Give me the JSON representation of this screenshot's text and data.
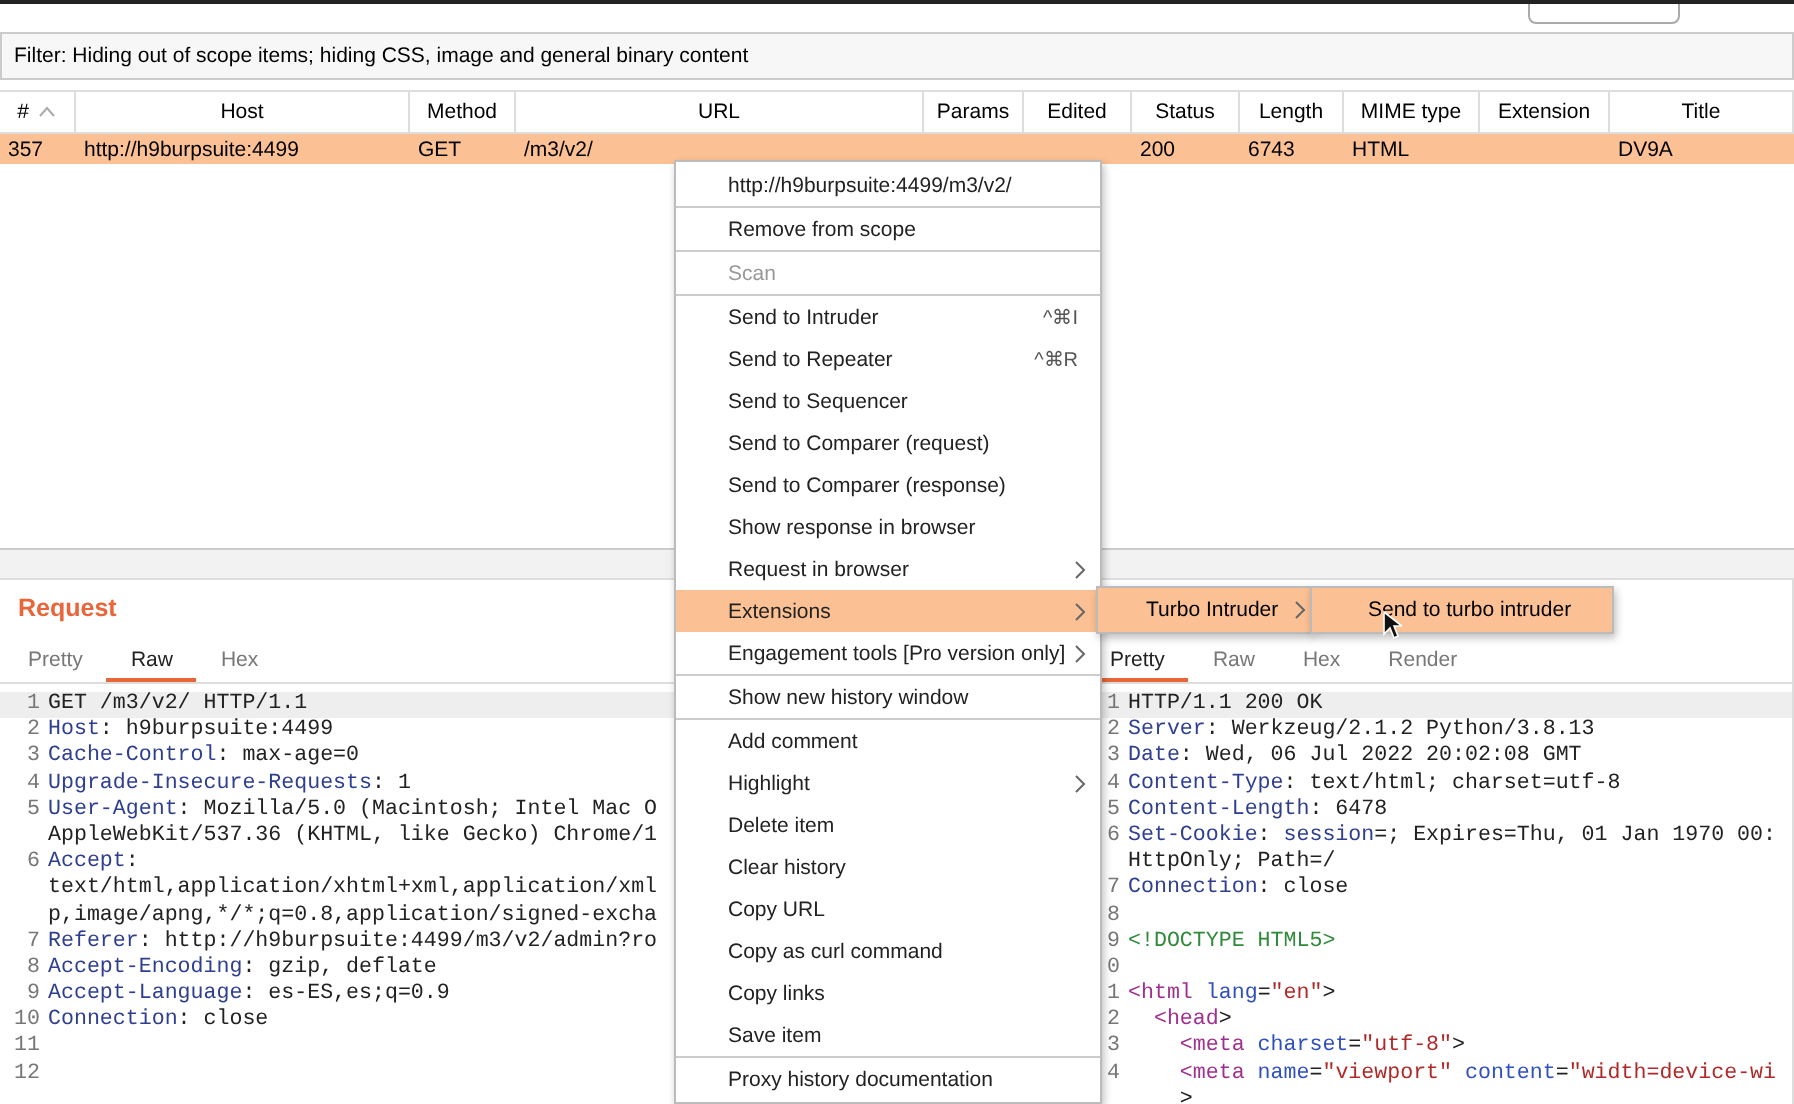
{
  "filter": "Filter: Hiding out of scope items;  hiding CSS, image and general binary content",
  "table": {
    "columns": [
      {
        "label": "#",
        "sorted": true
      },
      {
        "label": "Host",
        "sorted": false
      },
      {
        "label": "Method",
        "sorted": false
      },
      {
        "label": "URL",
        "sorted": false
      },
      {
        "label": "Params",
        "sorted": false
      },
      {
        "label": "Edited",
        "sorted": false
      },
      {
        "label": "Status",
        "sorted": false
      },
      {
        "label": "Length",
        "sorted": false
      },
      {
        "label": "MIME type",
        "sorted": false
      },
      {
        "label": "Extension",
        "sorted": false
      },
      {
        "label": "Title",
        "sorted": false
      }
    ],
    "rows": [
      {
        "selected": true,
        "cells": [
          "357",
          "http://h9burpsuite:4499",
          "GET",
          "/m3/v2/",
          null,
          null,
          "200",
          "6743",
          "HTML",
          null,
          "DV9A"
        ]
      }
    ]
  },
  "request": {
    "title": "Request",
    "tabs": [
      {
        "label": "Pretty",
        "selected": false
      },
      {
        "label": "Raw",
        "selected": true
      },
      {
        "label": "Hex",
        "selected": false
      }
    ],
    "lines": [
      {
        "n": "1",
        "segs": [
          {
            "kind": "plain",
            "text": "GET /m3/v2/ HTTP/1.1"
          }
        ]
      },
      {
        "n": "2",
        "segs": [
          {
            "kind": "key",
            "text": "Host"
          },
          {
            "kind": "plain",
            "text": ": h9burpsuite:4499"
          }
        ]
      },
      {
        "n": "3",
        "segs": [
          {
            "kind": "key",
            "text": "Cache-Control"
          },
          {
            "kind": "plain",
            "text": ": max-age=0"
          }
        ]
      },
      {
        "n": "4",
        "segs": [
          {
            "kind": "key",
            "text": "Upgrade-Insecure-Requests"
          },
          {
            "kind": "plain",
            "text": ": 1"
          }
        ]
      },
      {
        "n": "5",
        "segs": [
          {
            "kind": "key",
            "text": "User-Agent"
          },
          {
            "kind": "plain",
            "text": ": Mozilla/5.0 (Macintosh; Intel Mac O"
          }
        ]
      },
      {
        "segs": [
          {
            "kind": "plain",
            "text": "AppleWebKit/537.36 (KHTML, like Gecko) Chrome/1"
          }
        ]
      },
      {
        "n": "6",
        "segs": [
          {
            "kind": "key",
            "text": "Accept"
          },
          {
            "kind": "plain",
            "text": ":"
          }
        ]
      },
      {
        "segs": [
          {
            "kind": "plain",
            "text": "text/html,application/xhtml+xml,application/xml"
          }
        ]
      },
      {
        "segs": [
          {
            "kind": "plain",
            "text": "p,image/apng,*/*;q=0.8,application/signed-excha"
          }
        ]
      },
      {
        "n": "7",
        "segs": [
          {
            "kind": "key",
            "text": "Referer"
          },
          {
            "kind": "plain",
            "text": ": http://h9burpsuite:4499/m3/v2/admin?ro"
          }
        ]
      },
      {
        "n": "8",
        "segs": [
          {
            "kind": "key",
            "text": "Accept-Encoding"
          },
          {
            "kind": "plain",
            "text": ": gzip, deflate"
          }
        ]
      },
      {
        "n": "9",
        "segs": [
          {
            "kind": "key",
            "text": "Accept-Language"
          },
          {
            "kind": "plain",
            "text": ": es-ES,es;q=0.9"
          }
        ]
      },
      {
        "n": "10",
        "segs": [
          {
            "kind": "key",
            "text": "Connection"
          },
          {
            "kind": "plain",
            "text": ": close"
          }
        ]
      },
      {
        "n": "11"
      },
      {
        "n": "12"
      }
    ]
  },
  "response": {
    "tabs": [
      {
        "label": "Pretty",
        "selected": true
      },
      {
        "label": "Raw",
        "selected": false
      },
      {
        "label": "Hex",
        "selected": false
      },
      {
        "label": "Render",
        "selected": false
      }
    ],
    "lines": [
      {
        "n": "1",
        "segs": [
          {
            "kind": "plain",
            "text": "HTTP/1.1 200 OK"
          }
        ]
      },
      {
        "n": "2",
        "segs": [
          {
            "kind": "key",
            "text": "Server"
          },
          {
            "kind": "plain",
            "text": ": Werkzeug/2.1.2 Python/3.8.13"
          }
        ]
      },
      {
        "n": "3",
        "segs": [
          {
            "kind": "key",
            "text": "Date"
          },
          {
            "kind": "plain",
            "text": ": Wed, 06 Jul 2022 20:02:08 GMT"
          }
        ]
      },
      {
        "n": "4",
        "segs": [
          {
            "kind": "key",
            "text": "Content-Type"
          },
          {
            "kind": "plain",
            "text": ": text/html; charset=utf-8"
          }
        ]
      },
      {
        "n": "5",
        "segs": [
          {
            "kind": "key",
            "text": "Content-Length"
          },
          {
            "kind": "plain",
            "text": ": 6478"
          }
        ]
      },
      {
        "n": "6",
        "segs": [
          {
            "kind": "key",
            "text": "Set-Cookie"
          },
          {
            "kind": "plain",
            "text": ": "
          },
          {
            "kind": "key",
            "text": "session"
          },
          {
            "kind": "plain",
            "text": "=; Expires=Thu, 01 Jan 1970 00:"
          }
        ]
      },
      {
        "segs": [
          {
            "kind": "plain",
            "text": "HttpOnly; Path=/"
          }
        ]
      },
      {
        "n": "7",
        "segs": [
          {
            "kind": "key",
            "text": "Connection"
          },
          {
            "kind": "plain",
            "text": ": close"
          }
        ]
      },
      {
        "n": "8"
      },
      {
        "n": "9",
        "segs": [
          {
            "kind": "doctype",
            "text": "<!DOCTYPE HTML5>"
          }
        ]
      },
      {
        "n": "0"
      },
      {
        "n": "1",
        "segs": [
          {
            "kind": "tag",
            "text": "<html"
          },
          {
            "kind": "attr",
            "text": " lang"
          },
          {
            "kind": "plain",
            "text": "="
          },
          {
            "kind": "string",
            "text": "\"en\""
          },
          {
            "kind": "plain",
            "text": ">"
          }
        ]
      },
      {
        "n": "2",
        "segs": [
          {
            "kind": "tag",
            "text": "  <head"
          },
          {
            "kind": "plain",
            "text": ">"
          }
        ]
      },
      {
        "n": "3",
        "segs": [
          {
            "kind": "tag",
            "text": "    <meta"
          },
          {
            "kind": "attr",
            "text": " charset"
          },
          {
            "kind": "plain",
            "text": "="
          },
          {
            "kind": "string",
            "text": "\"utf-8\""
          },
          {
            "kind": "plain",
            "text": ">"
          }
        ]
      },
      {
        "n": "4",
        "segs": [
          {
            "kind": "tag",
            "text": "    <meta"
          },
          {
            "kind": "attr",
            "text": " name"
          },
          {
            "kind": "plain",
            "text": "="
          },
          {
            "kind": "string",
            "text": "\"viewport\""
          },
          {
            "kind": "attr",
            "text": " content"
          },
          {
            "kind": "plain",
            "text": "="
          },
          {
            "kind": "string",
            "text": "\"width=device-wi"
          }
        ]
      },
      {
        "segs": [
          {
            "kind": "plain",
            "text": "    >"
          }
        ]
      }
    ]
  },
  "context_menu": {
    "groups": [
      [
        {
          "label": "http://h9burpsuite:4499/m3/v2/",
          "disabled": false,
          "selected": false,
          "submenu": false
        }
      ],
      [
        {
          "label": "Remove from scope",
          "disabled": false,
          "selected": false,
          "submenu": false
        }
      ],
      [
        {
          "label": "Scan",
          "disabled": true,
          "selected": false,
          "submenu": false
        }
      ],
      [
        {
          "label": "Send to Intruder",
          "shortcut": "^⌘I",
          "disabled": false,
          "selected": false,
          "submenu": false
        },
        {
          "label": "Send to Repeater",
          "shortcut": "^⌘R",
          "disabled": false,
          "selected": false,
          "submenu": false
        },
        {
          "label": "Send to Sequencer",
          "disabled": false,
          "selected": false,
          "submenu": false
        },
        {
          "label": "Send to Comparer (request)",
          "disabled": false,
          "selected": false,
          "submenu": false
        },
        {
          "label": "Send to Comparer (response)",
          "disabled": false,
          "selected": false,
          "submenu": false
        },
        {
          "label": "Show response in browser",
          "disabled": false,
          "selected": false,
          "submenu": false
        },
        {
          "label": "Request in browser",
          "disabled": false,
          "selected": false,
          "submenu": true
        },
        {
          "label": "Extensions",
          "disabled": false,
          "selected": true,
          "submenu": true
        },
        {
          "label": "Engagement tools [Pro version only]",
          "disabled": false,
          "selected": false,
          "submenu": true
        }
      ],
      [
        {
          "label": "Show new history window",
          "disabled": false,
          "selected": false,
          "submenu": false
        }
      ],
      [
        {
          "label": "Add comment",
          "disabled": false,
          "selected": false,
          "submenu": false
        },
        {
          "label": "Highlight",
          "disabled": false,
          "selected": false,
          "submenu": true
        },
        {
          "label": "Delete item",
          "disabled": false,
          "selected": false,
          "submenu": false
        },
        {
          "label": "Clear history",
          "disabled": false,
          "selected": false,
          "submenu": false
        },
        {
          "label": "Copy URL",
          "disabled": false,
          "selected": false,
          "submenu": false
        },
        {
          "label": "Copy as curl command",
          "disabled": false,
          "selected": false,
          "submenu": false
        },
        {
          "label": "Copy links",
          "disabled": false,
          "selected": false,
          "submenu": false
        },
        {
          "label": "Save item",
          "disabled": false,
          "selected": false,
          "submenu": false
        }
      ],
      [
        {
          "label": "Proxy history documentation",
          "disabled": false,
          "selected": false,
          "submenu": false
        }
      ]
    ]
  },
  "submenu": {
    "label": "Turbo Intruder",
    "selected": true,
    "submenu": true
  },
  "submenu_2": {
    "label": "Send to turbo intruder",
    "selected": true
  }
}
